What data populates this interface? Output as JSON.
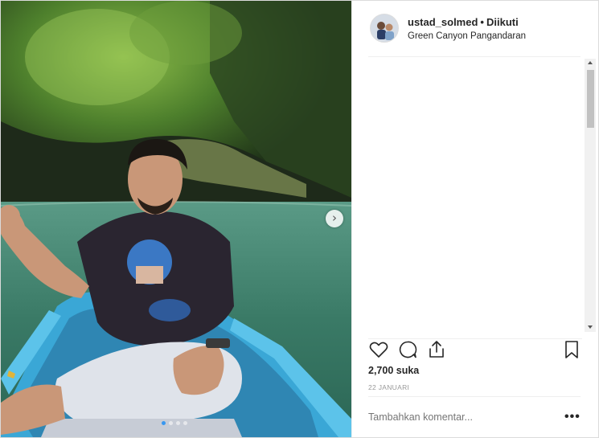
{
  "post": {
    "username": "ustad_solmed",
    "separator": "•",
    "follow_status": "Diikuti",
    "location": "Green Canyon Pangandaran",
    "likes": "2,700 suka",
    "date": "22 JANUARI",
    "comment_placeholder": "Tambahkan komentar...",
    "more_label": "•••"
  },
  "carousel": {
    "next_label": "›",
    "slide_count": 4,
    "active_slide": 1
  },
  "icons": {
    "like": "heart-icon",
    "comment": "comment-icon",
    "share": "share-icon",
    "save": "bookmark-icon"
  },
  "colors": {
    "accent": "#3897f0",
    "text": "#262626",
    "muted": "#999999",
    "border": "#efefef"
  }
}
